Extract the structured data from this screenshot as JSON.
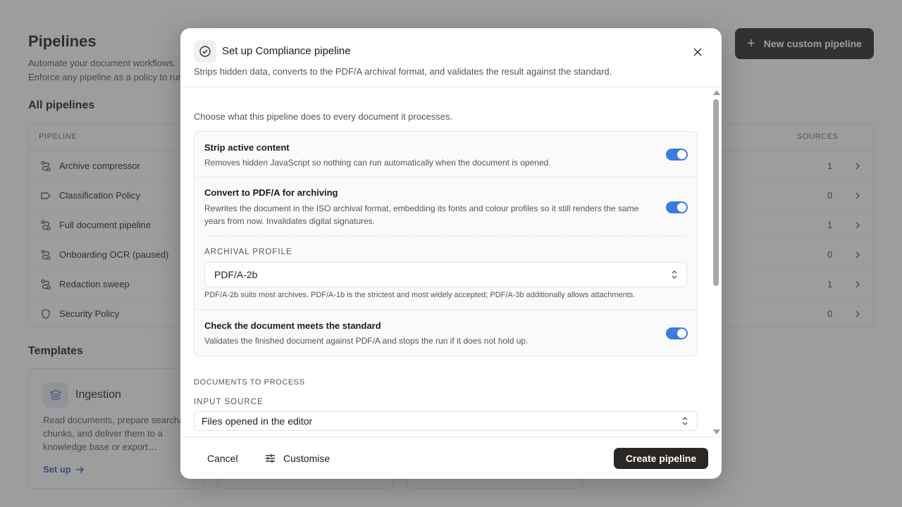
{
  "page": {
    "title": "Pipelines",
    "description_line1": "Automate your document workflows.",
    "description_line2": "Enforce any pipeline as a policy to run",
    "new_button": "New custom pipeline",
    "all_heading": "All pipelines",
    "templates_heading": "Templates"
  },
  "table": {
    "col_pipeline": "PIPELINE",
    "col_sources": "SOURCES",
    "rows": [
      {
        "name": "Archive compressor",
        "sources": "1",
        "icon": "pipeline-icon"
      },
      {
        "name": "Classification Policy",
        "sources": "0",
        "icon": "tag-icon"
      },
      {
        "name": "Full document pipeline",
        "sources": "1",
        "icon": "pipeline-icon"
      },
      {
        "name": "Onboarding OCR (paused)",
        "sources": "0",
        "icon": "pipeline-icon"
      },
      {
        "name": "Redaction sweep",
        "sources": "1",
        "icon": "pipeline-icon"
      },
      {
        "name": "Security Policy",
        "sources": "0",
        "icon": "shield-icon"
      }
    ]
  },
  "template_card": {
    "title": "Ingestion",
    "description": "Read documents, prepare searcha\nchunks, and deliver them to a\nknowledge base or export…",
    "link": "Set up"
  },
  "modal": {
    "title": "Set up Compliance pipeline",
    "subtitle": "Strips hidden data, converts to the PDF/A archival format, and validates the result against the standard.",
    "intro": "Choose what this pipeline does to every document it processes.",
    "options": [
      {
        "title": "Strip active content",
        "description": "Removes hidden JavaScript so nothing can run automatically when the document is opened.",
        "enabled": true
      },
      {
        "title": "Convert to PDF/A for archiving",
        "description": "Rewrites the document in the ISO archival format, embedding its fonts and colour profiles so it still renders the same years from now. Invalidates digital signatures.",
        "enabled": true
      },
      {
        "title": "Check the document meets the standard",
        "description": "Validates the finished document against PDF/A and stops the run if it does not hold up.",
        "enabled": true
      }
    ],
    "archival_profile_label": "ARCHIVAL PROFILE",
    "archival_profile_value": "PDF/A-2b",
    "archival_profile_hint": "PDF/A-2b suits most archives. PDF/A-1b is the strictest and most widely accepted; PDF/A-3b additionally allows attachments.",
    "documents_heading": "DOCUMENTS TO PROCESS",
    "input_source_label": "INPUT SOURCE",
    "input_source_value": "Files opened in the editor",
    "cancel": "Cancel",
    "customise": "Customise",
    "create": "Create pipeline"
  },
  "colors": {
    "toggle_on": "#3b7be0",
    "primary_button": "#2a2724",
    "link": "#2a5bbf"
  }
}
